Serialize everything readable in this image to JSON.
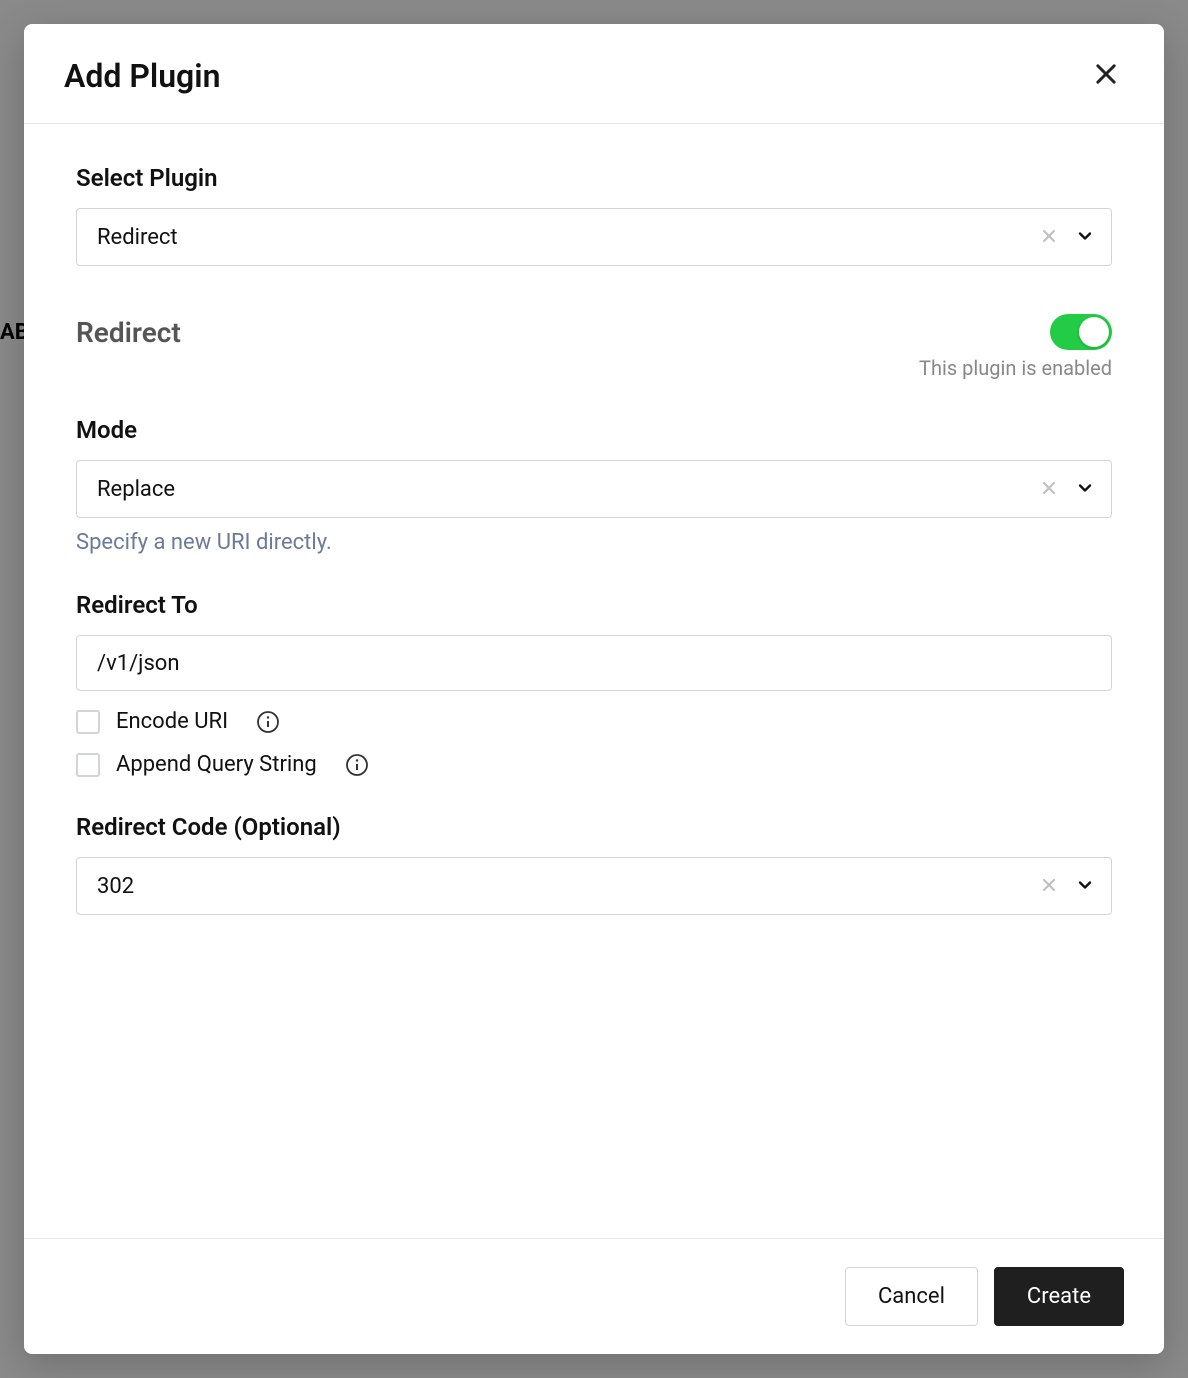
{
  "modal": {
    "title": "Add Plugin"
  },
  "selectPlugin": {
    "label": "Select Plugin",
    "value": "Redirect"
  },
  "plugin": {
    "name": "Redirect",
    "enabledStatus": "This plugin is enabled"
  },
  "mode": {
    "label": "Mode",
    "value": "Replace",
    "help": "Specify a new URI directly."
  },
  "redirectTo": {
    "label": "Redirect To",
    "value": "/v1/json"
  },
  "encodeUri": {
    "label": "Encode URI"
  },
  "appendQuery": {
    "label": "Append Query String"
  },
  "redirectCode": {
    "label": "Redirect Code (Optional)",
    "value": "302"
  },
  "footer": {
    "cancel": "Cancel",
    "create": "Create"
  },
  "backdrop": {
    "text": "AB"
  }
}
